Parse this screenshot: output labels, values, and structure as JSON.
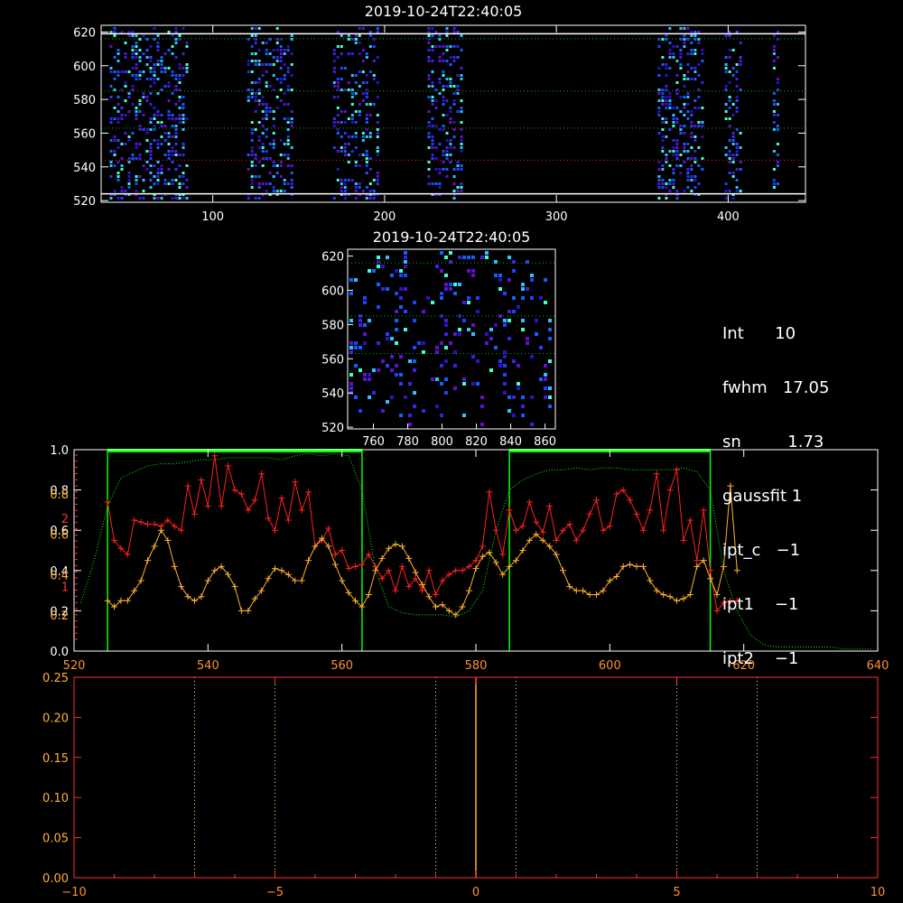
{
  "panel1": {
    "title": "2019-10-24T22:40:05",
    "xticks": [
      "100",
      "200",
      "300",
      "400"
    ],
    "xtick_values": [
      100,
      200,
      300,
      400
    ],
    "xlim": [
      35,
      445
    ],
    "yticks": [
      "520",
      "540",
      "560",
      "580",
      "600",
      "620"
    ],
    "ylim": [
      519,
      624
    ],
    "hlines_white": [
      524,
      619
    ],
    "hlines_green": [
      563,
      585,
      616
    ],
    "hline_red": 544,
    "stripes": [
      [
        40,
        86
      ],
      [
        120,
        146
      ],
      [
        170,
        196
      ],
      [
        225,
        245
      ],
      [
        359,
        385
      ],
      [
        398,
        408
      ],
      [
        426,
        430
      ]
    ]
  },
  "panel2": {
    "title": "2019-10-24T22:40:05",
    "xticks": [
      "760",
      "780",
      "800",
      "820",
      "840",
      "860"
    ],
    "xtick_values": [
      760,
      780,
      800,
      820,
      840,
      860
    ],
    "xlim": [
      745,
      866
    ],
    "yticks": [
      "520",
      "540",
      "560",
      "580",
      "600",
      "620"
    ],
    "ylim": [
      519,
      624
    ],
    "hlines_green": [
      563,
      585,
      616
    ]
  },
  "info": [
    {
      "label": "Int",
      "value": "10"
    },
    {
      "label": "fwhm",
      "value": "17.05"
    },
    {
      "label": "sn",
      "value": "1.73"
    },
    {
      "label": "gaussfit",
      "value": "1"
    },
    {
      "label": "ipt_c",
      "value": "−1"
    },
    {
      "label": "ipt1",
      "value": "−1"
    },
    {
      "label": "ipt2",
      "value": "−1"
    }
  ],
  "panel3": {
    "xticks": [
      "520",
      "540",
      "560",
      "580",
      "600",
      "620",
      "640"
    ],
    "xtick_values": [
      520,
      540,
      560,
      580,
      600,
      620,
      640
    ],
    "xlim": [
      520,
      640
    ],
    "yticks_white": [
      "0.0",
      "0.2",
      "0.4",
      "0.6",
      "0.8",
      "1.0"
    ],
    "ytick_white_values": [
      0.0,
      0.2,
      0.4,
      0.6,
      0.8,
      1.0
    ],
    "yticks_orange": [
      "0.2",
      "0.4",
      "0.6",
      "0.8"
    ],
    "yticks_red": [
      "1",
      "2"
    ],
    "colors": {
      "red": "#ff2020",
      "orange": "#ffb030",
      "green": "#00ff00",
      "axis": "#ffffff"
    }
  },
  "panel4": {
    "xticks": [
      "−10",
      "−5",
      "0",
      "5",
      "10"
    ],
    "xtick_values": [
      -10,
      -5,
      0,
      5,
      10
    ],
    "xlim": [
      -10,
      10
    ],
    "yticks": [
      "0.00",
      "0.05",
      "0.10",
      "0.15",
      "0.20",
      "0.25"
    ],
    "ytick_values": [
      0.0,
      0.05,
      0.1,
      0.15,
      0.2,
      0.25
    ],
    "ylim": [
      0,
      0.25
    ],
    "dotted_x": [
      -7,
      -5,
      -1,
      1,
      5,
      7
    ],
    "spike_x": 0
  },
  "chart_data": [
    {
      "type": "line",
      "panel": "profile",
      "xlim": [
        520,
        640
      ],
      "ylim": [
        0,
        1.0
      ],
      "green_boxes": [
        [
          525,
          563
        ],
        [
          585,
          615
        ]
      ],
      "series": [
        {
          "color": "#00ff00",
          "style": "dotted",
          "x": [
            521,
            523,
            525,
            527,
            529,
            531,
            533,
            535,
            537,
            539,
            541,
            543,
            545,
            547,
            549,
            551,
            553,
            555,
            557,
            559,
            561,
            563,
            565,
            567,
            569,
            571,
            573,
            575,
            577,
            579,
            581,
            583,
            585,
            587,
            589,
            591,
            593,
            595,
            597,
            599,
            601,
            603,
            605,
            607,
            609,
            611,
            613,
            615,
            617,
            619,
            621,
            623,
            625,
            627,
            629,
            631,
            633,
            635,
            637,
            639
          ],
          "values": [
            0.24,
            0.45,
            0.72,
            0.86,
            0.89,
            0.92,
            0.93,
            0.93,
            0.94,
            0.95,
            0.95,
            0.96,
            0.96,
            0.96,
            0.96,
            0.95,
            0.97,
            0.98,
            0.97,
            0.98,
            0.97,
            0.8,
            0.4,
            0.22,
            0.19,
            0.18,
            0.18,
            0.18,
            0.17,
            0.2,
            0.3,
            0.6,
            0.8,
            0.85,
            0.88,
            0.9,
            0.9,
            0.91,
            0.9,
            0.91,
            0.91,
            0.9,
            0.9,
            0.9,
            0.9,
            0.91,
            0.89,
            0.8,
            0.4,
            0.2,
            0.08,
            0.03,
            0.02,
            0.02,
            0.02,
            0.02,
            0.02,
            0.01,
            0.01,
            0.01
          ]
        },
        {
          "color": "#ff2020",
          "style": "solid-plus",
          "x": [
            525,
            526,
            527,
            528,
            529,
            530,
            531,
            532,
            533,
            534,
            535,
            536,
            537,
            538,
            539,
            540,
            541,
            542,
            543,
            544,
            545,
            546,
            547,
            548,
            549,
            550,
            551,
            552,
            553,
            554,
            555,
            556,
            557,
            558,
            559,
            560,
            561,
            562,
            563,
            564,
            565,
            566,
            567,
            568,
            569,
            570,
            571,
            572,
            573,
            574,
            575,
            576,
            577,
            578,
            579,
            580,
            581,
            582,
            583,
            584,
            585,
            586,
            587,
            588,
            589,
            590,
            591,
            592,
            593,
            594,
            595,
            596,
            597,
            598,
            599,
            600,
            601,
            602,
            603,
            604,
            605,
            606,
            607,
            608,
            609,
            610,
            611,
            612,
            613,
            614,
            615,
            616,
            617,
            618,
            619
          ],
          "values": [
            0.74,
            0.55,
            0.51,
            0.48,
            0.65,
            0.64,
            0.63,
            0.63,
            0.62,
            0.65,
            0.62,
            0.6,
            0.82,
            0.68,
            0.85,
            0.72,
            0.97,
            0.72,
            0.92,
            0.8,
            0.78,
            0.7,
            0.75,
            0.88,
            0.66,
            0.6,
            0.76,
            0.65,
            0.84,
            0.7,
            0.79,
            0.52,
            0.55,
            0.61,
            0.48,
            0.5,
            0.41,
            0.42,
            0.43,
            0.48,
            0.42,
            0.36,
            0.4,
            0.3,
            0.42,
            0.32,
            0.36,
            0.3,
            0.4,
            0.28,
            0.35,
            0.38,
            0.4,
            0.4,
            0.42,
            0.45,
            0.52,
            0.79,
            0.6,
            0.48,
            0.7,
            0.6,
            0.62,
            0.74,
            0.64,
            0.59,
            0.72,
            0.55,
            0.6,
            0.63,
            0.55,
            0.6,
            0.68,
            0.75,
            0.6,
            0.62,
            0.78,
            0.8,
            0.75,
            0.68,
            0.6,
            0.7,
            0.88,
            0.6,
            0.8,
            0.9,
            0.55,
            0.65,
            0.45,
            0.7,
            0.4,
            0.2,
            0.24,
            0.25,
            0.25
          ]
        },
        {
          "color": "#ffb030",
          "style": "solid-plus",
          "x": [
            525,
            526,
            527,
            528,
            529,
            530,
            531,
            532,
            533,
            534,
            535,
            536,
            537,
            538,
            539,
            540,
            541,
            542,
            543,
            544,
            545,
            546,
            547,
            548,
            549,
            550,
            551,
            552,
            553,
            554,
            555,
            556,
            557,
            558,
            559,
            560,
            561,
            562,
            563,
            564,
            565,
            566,
            567,
            568,
            569,
            570,
            571,
            572,
            573,
            574,
            575,
            576,
            577,
            578,
            579,
            580,
            581,
            582,
            583,
            584,
            585,
            586,
            587,
            588,
            589,
            590,
            591,
            592,
            593,
            594,
            595,
            596,
            597,
            598,
            599,
            600,
            601,
            602,
            603,
            604,
            605,
            606,
            607,
            608,
            609,
            610,
            611,
            612,
            613,
            614,
            615,
            616,
            617,
            618,
            619
          ],
          "values": [
            0.25,
            0.22,
            0.25,
            0.25,
            0.3,
            0.35,
            0.45,
            0.52,
            0.6,
            0.55,
            0.42,
            0.32,
            0.27,
            0.25,
            0.27,
            0.35,
            0.4,
            0.42,
            0.38,
            0.32,
            0.2,
            0.2,
            0.26,
            0.3,
            0.36,
            0.41,
            0.4,
            0.38,
            0.35,
            0.35,
            0.45,
            0.52,
            0.56,
            0.52,
            0.43,
            0.35,
            0.29,
            0.25,
            0.22,
            0.28,
            0.4,
            0.46,
            0.51,
            0.53,
            0.52,
            0.46,
            0.39,
            0.33,
            0.27,
            0.22,
            0.23,
            0.2,
            0.18,
            0.22,
            0.3,
            0.41,
            0.47,
            0.49,
            0.44,
            0.38,
            0.42,
            0.45,
            0.5,
            0.55,
            0.58,
            0.55,
            0.52,
            0.48,
            0.4,
            0.32,
            0.3,
            0.3,
            0.28,
            0.28,
            0.3,
            0.35,
            0.37,
            0.42,
            0.43,
            0.42,
            0.42,
            0.35,
            0.3,
            0.28,
            0.27,
            0.25,
            0.26,
            0.28,
            0.42,
            0.45,
            0.36,
            0.28,
            0.42,
            0.82,
            0.4
          ]
        }
      ]
    }
  ]
}
